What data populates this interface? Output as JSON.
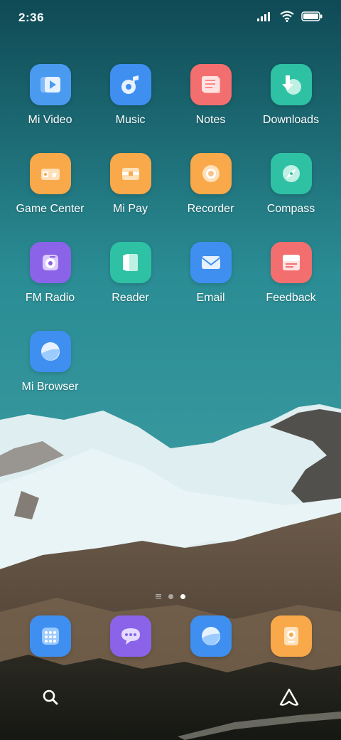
{
  "status_bar": {
    "time": "2:36",
    "icons": [
      "signal-icon",
      "wifi-icon",
      "battery-icon"
    ]
  },
  "home_grid": {
    "rows": [
      [
        {
          "label": "Mi Video",
          "icon": "mi-video-icon",
          "color": "#4a9bf0"
        },
        {
          "label": "Music",
          "icon": "music-icon",
          "color": "#3f8ff0"
        },
        {
          "label": "Notes",
          "icon": "notes-icon",
          "color": "#f36f6f"
        },
        {
          "label": "Downloads",
          "icon": "downloads-icon",
          "color": "#2fc1a3"
        }
      ],
      [
        {
          "label": "Game Center",
          "icon": "game-center-icon",
          "color": "#f9a84a"
        },
        {
          "label": "Mi Pay",
          "icon": "mi-pay-icon",
          "color": "#f9a84a"
        },
        {
          "label": "Recorder",
          "icon": "recorder-icon",
          "color": "#f9a84a"
        },
        {
          "label": "Compass",
          "icon": "compass-icon",
          "color": "#2fc1a3"
        }
      ],
      [
        {
          "label": "FM Radio",
          "icon": "fm-radio-icon",
          "color": "#8a63e8"
        },
        {
          "label": "Reader",
          "icon": "reader-icon",
          "color": "#2fc1a3"
        },
        {
          "label": "Email",
          "icon": "email-icon",
          "color": "#3f8ff0"
        },
        {
          "label": "Feedback",
          "icon": "feedback-icon",
          "color": "#f36f6f"
        }
      ],
      [
        {
          "label": "Mi Browser",
          "icon": "mi-browser-icon",
          "color": "#3f8ff0"
        }
      ]
    ]
  },
  "page_indicator": {
    "pages": 2,
    "current": 2
  },
  "dock": [
    {
      "icon": "phone-dialer-icon",
      "color": "#3f8ff0"
    },
    {
      "icon": "messaging-icon",
      "color": "#8a63e8"
    },
    {
      "icon": "browser-icon",
      "color": "#3f8ff0"
    },
    {
      "icon": "camera-icon",
      "color": "#f9a84a"
    }
  ],
  "search_bar": {
    "left_icon": "search-icon",
    "right_icon": "assistant-icon"
  }
}
